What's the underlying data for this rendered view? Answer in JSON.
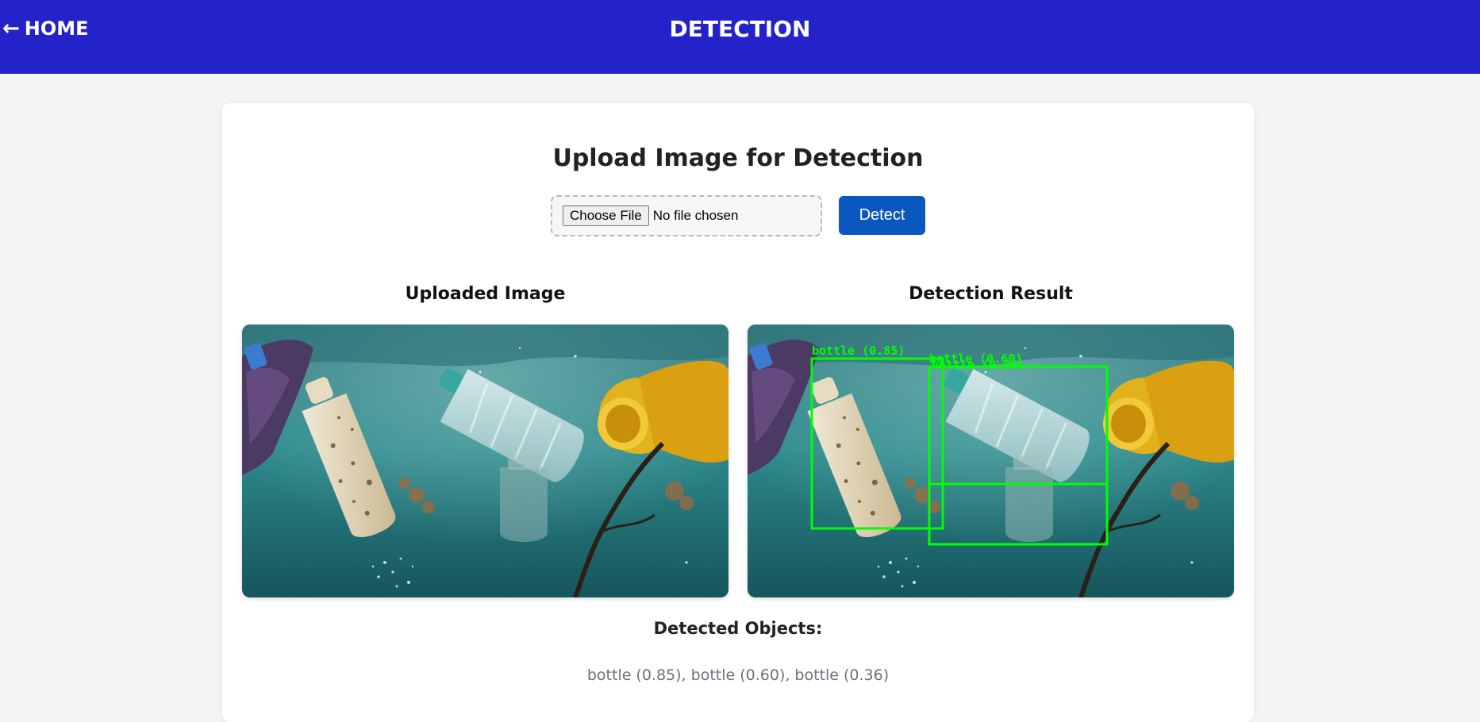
{
  "header": {
    "home_arrow": "←",
    "home_label": "HOME",
    "title": "DETECTION",
    "bg_color": "#2422c9"
  },
  "upload": {
    "title": "Upload Image for Detection",
    "choose_file_label": "Choose File",
    "file_status": "No file chosen",
    "detect_label": "Detect",
    "detect_color": "#0b57c0"
  },
  "panels": {
    "uploaded_title": "Uploaded Image",
    "result_title": "Detection Result",
    "box_color": "#00ff00",
    "boxes": [
      {
        "label": "bottle (0.85)"
      },
      {
        "label": "bottle (0.60)"
      },
      {
        "label": "bottle (0.36)"
      }
    ]
  },
  "results": {
    "title": "Detected Objects:",
    "list": "bottle (0.85), bottle (0.60), bottle (0.36)"
  }
}
